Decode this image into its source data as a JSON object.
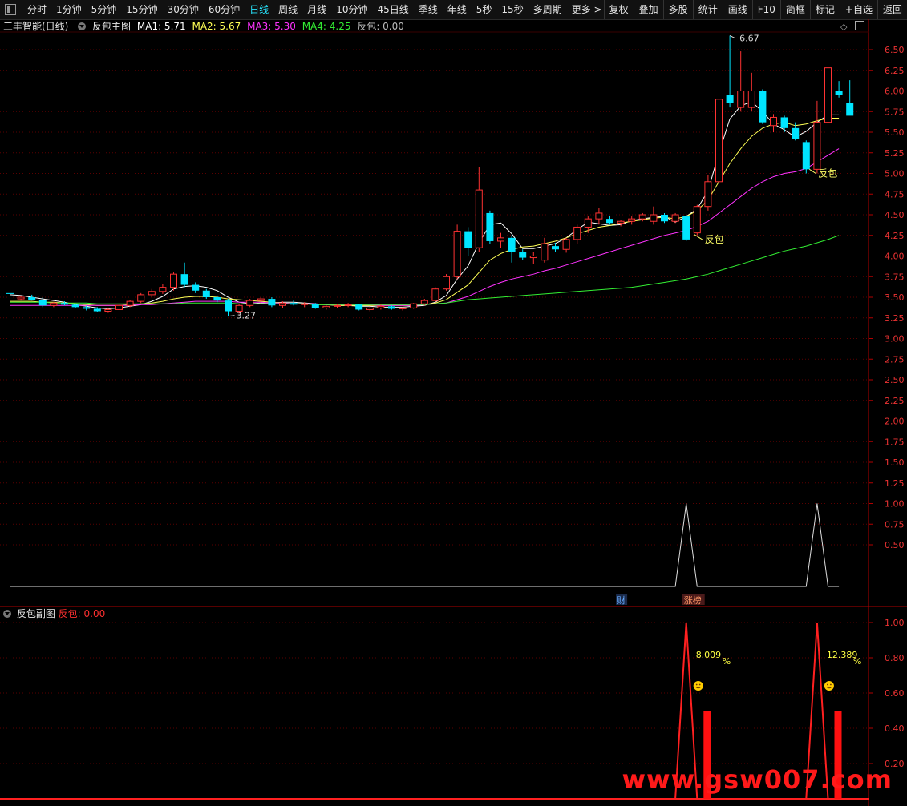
{
  "toolbar": {
    "left_items": [
      "分时",
      "1分钟",
      "5分钟",
      "15分钟",
      "30分钟",
      "60分钟",
      "日线",
      "周线",
      "月线",
      "10分钟",
      "45日线",
      "季线",
      "年线",
      "5秒",
      "15秒",
      "多周期",
      "更多 >"
    ],
    "active": "日线",
    "right_items": [
      "复权",
      "叠加",
      "多股",
      "统计",
      "画线",
      "F10",
      "简框",
      "标记",
      "+自选",
      "返回"
    ]
  },
  "main_header": {
    "title": "三丰智能(日线)",
    "indicator": "反包主图",
    "ma1": "MA1: 5.71",
    "ma2": "MA2: 5.67",
    "ma3": "MA3: 5.30",
    "ma4": "MA4: 4.25",
    "fanbao": "反包: 0.00"
  },
  "sub_header": {
    "indicator": "反包副图",
    "fanbao": "反包: 0.00"
  },
  "colors": {
    "up": "#ff3232",
    "down": "#00e5ff",
    "ma1": "#ffffff",
    "ma2": "#ffff55",
    "ma3": "#ff33ff",
    "ma4": "#33ee33",
    "axis": "#c00000"
  },
  "annotations": {
    "high_label": "6.67",
    "low_label": "3.27",
    "fanbao_label_1": "反包",
    "fanbao_label_2": "反包",
    "badge_cai": "财",
    "badge_zhangbang": "涨榜",
    "pct_1": "8.009",
    "pct_2": "12.389",
    "pct_unit": "%",
    "watermark": "www.gsw007.com"
  },
  "chart_data": [
    {
      "type": "candlestick",
      "title": "三丰智能(日线)",
      "ylim": [
        2.9,
        6.7
      ],
      "y_ticks": [
        "6.50",
        "6.25",
        "6.00",
        "5.75",
        "5.50",
        "5.25",
        "5.00",
        "4.75",
        "4.50",
        "4.25",
        "4.00",
        "3.75",
        "3.50",
        "3.25",
        "3.00",
        "2.75",
        "2.50",
        "2.25",
        "2.00",
        "1.75",
        "1.50",
        "1.25",
        "1.00",
        "0.75",
        "0.50"
      ],
      "candles": [
        [
          3.55,
          3.56,
          3.53,
          3.54
        ],
        [
          3.48,
          3.52,
          3.46,
          3.5
        ],
        [
          3.5,
          3.53,
          3.46,
          3.47
        ],
        [
          3.47,
          3.5,
          3.38,
          3.4
        ],
        [
          3.4,
          3.44,
          3.38,
          3.43
        ],
        [
          3.43,
          3.45,
          3.4,
          3.41
        ],
        [
          3.41,
          3.42,
          3.37,
          3.38
        ],
        [
          3.38,
          3.4,
          3.34,
          3.36
        ],
        [
          3.36,
          3.38,
          3.32,
          3.33
        ],
        [
          3.33,
          3.37,
          3.31,
          3.35
        ],
        [
          3.35,
          3.42,
          3.33,
          3.4
        ],
        [
          3.4,
          3.47,
          3.38,
          3.45
        ],
        [
          3.45,
          3.55,
          3.43,
          3.53
        ],
        [
          3.53,
          3.6,
          3.5,
          3.57
        ],
        [
          3.57,
          3.66,
          3.54,
          3.62
        ],
        [
          3.62,
          3.8,
          3.58,
          3.78
        ],
        [
          3.78,
          3.92,
          3.62,
          3.65
        ],
        [
          3.65,
          3.68,
          3.55,
          3.58
        ],
        [
          3.58,
          3.6,
          3.48,
          3.5
        ],
        [
          3.5,
          3.52,
          3.44,
          3.46
        ],
        [
          3.46,
          3.48,
          3.27,
          3.33
        ],
        [
          3.33,
          3.42,
          3.3,
          3.4
        ],
        [
          3.4,
          3.48,
          3.38,
          3.46
        ],
        [
          3.46,
          3.5,
          3.42,
          3.48
        ],
        [
          3.48,
          3.5,
          3.38,
          3.4
        ],
        [
          3.4,
          3.45,
          3.37,
          3.43
        ],
        [
          3.43,
          3.46,
          3.4,
          3.41
        ],
        [
          3.41,
          3.44,
          3.38,
          3.42
        ],
        [
          3.42,
          3.43,
          3.36,
          3.37
        ],
        [
          3.37,
          3.4,
          3.35,
          3.39
        ],
        [
          3.39,
          3.42,
          3.37,
          3.4
        ],
        [
          3.4,
          3.43,
          3.38,
          3.41
        ],
        [
          3.41,
          3.42,
          3.34,
          3.35
        ],
        [
          3.35,
          3.39,
          3.33,
          3.37
        ],
        [
          3.37,
          3.41,
          3.35,
          3.39
        ],
        [
          3.39,
          3.4,
          3.35,
          3.36
        ],
        [
          3.36,
          3.38,
          3.34,
          3.37
        ],
        [
          3.37,
          3.43,
          3.36,
          3.42
        ],
        [
          3.42,
          3.48,
          3.4,
          3.46
        ],
        [
          3.46,
          3.62,
          3.44,
          3.6
        ],
        [
          3.6,
          3.78,
          3.58,
          3.75
        ],
        [
          3.75,
          4.38,
          3.72,
          4.3
        ],
        [
          4.3,
          4.35,
          4.0,
          4.1
        ],
        [
          4.1,
          5.08,
          4.05,
          4.8
        ],
        [
          4.52,
          4.55,
          4.15,
          4.18
        ],
        [
          4.18,
          4.28,
          4.1,
          4.22
        ],
        [
          4.22,
          4.25,
          3.92,
          4.05
        ],
        [
          4.05,
          4.08,
          3.95,
          3.98
        ],
        [
          3.98,
          4.05,
          3.9,
          4.0
        ],
        [
          3.95,
          4.22,
          3.92,
          4.15
        ],
        [
          4.12,
          4.16,
          4.05,
          4.08
        ],
        [
          4.08,
          4.22,
          4.04,
          4.2
        ],
        [
          4.2,
          4.38,
          4.15,
          4.35
        ],
        [
          4.35,
          4.48,
          4.28,
          4.45
        ],
        [
          4.45,
          4.58,
          4.38,
          4.52
        ],
        [
          4.45,
          4.48,
          4.38,
          4.4
        ],
        [
          4.4,
          4.44,
          4.36,
          4.42
        ],
        [
          4.42,
          4.48,
          4.38,
          4.45
        ],
        [
          4.45,
          4.52,
          4.42,
          4.5
        ],
        [
          4.42,
          4.6,
          4.38,
          4.5
        ],
        [
          4.5,
          4.52,
          4.4,
          4.42
        ],
        [
          4.42,
          4.52,
          4.4,
          4.5
        ],
        [
          4.48,
          4.5,
          4.18,
          4.2
        ],
        [
          4.28,
          4.62,
          4.25,
          4.6
        ],
        [
          4.6,
          4.98,
          4.55,
          4.9
        ],
        [
          4.9,
          5.95,
          4.85,
          5.9
        ],
        [
          5.95,
          6.67,
          5.8,
          5.85
        ],
        [
          5.8,
          6.48,
          5.75,
          6.0
        ],
        [
          5.8,
          6.22,
          5.75,
          6.0
        ],
        [
          6.0,
          6.02,
          5.6,
          5.62
        ],
        [
          5.58,
          5.72,
          5.5,
          5.68
        ],
        [
          5.68,
          5.7,
          5.5,
          5.55
        ],
        [
          5.55,
          5.62,
          5.4,
          5.42
        ],
        [
          5.38,
          5.4,
          5.0,
          5.05
        ],
        [
          5.05,
          5.88,
          5.0,
          5.62
        ],
        [
          5.62,
          6.35,
          5.6,
          6.28
        ],
        [
          6.0,
          6.12,
          5.92,
          5.95
        ],
        [
          5.85,
          6.13,
          5.72,
          5.7
        ]
      ],
      "series": [
        {
          "name": "MA1",
          "values": [
            3.53,
            3.52,
            3.5,
            3.48,
            3.46,
            3.44,
            3.41,
            3.39,
            3.37,
            3.36,
            3.37,
            3.39,
            3.41,
            3.45,
            3.51,
            3.6,
            3.63,
            3.64,
            3.62,
            3.58,
            3.5,
            3.44,
            3.42,
            3.43,
            3.43,
            3.44,
            3.44,
            3.43,
            3.42,
            3.41,
            3.4,
            3.4,
            3.39,
            3.39,
            3.38,
            3.38,
            3.38,
            3.39,
            3.4,
            3.44,
            3.52,
            3.72,
            3.88,
            4.16,
            4.38,
            4.4,
            4.27,
            4.09,
            4.09,
            4.12,
            4.15,
            4.22,
            4.32,
            4.41,
            4.39,
            4.37,
            4.38,
            4.43,
            4.45,
            4.47,
            4.48,
            4.41,
            4.48,
            4.57,
            4.79,
            5.25,
            5.66,
            5.82,
            5.87,
            5.75,
            5.6,
            5.53,
            5.44,
            5.51,
            5.62,
            5.71,
            5.71
          ]
        },
        {
          "name": "MA2",
          "values": [
            3.45,
            3.45,
            3.45,
            3.44,
            3.44,
            3.43,
            3.42,
            3.41,
            3.4,
            3.4,
            3.4,
            3.41,
            3.42,
            3.43,
            3.45,
            3.48,
            3.5,
            3.51,
            3.51,
            3.5,
            3.48,
            3.47,
            3.46,
            3.45,
            3.44,
            3.43,
            3.42,
            3.42,
            3.41,
            3.41,
            3.4,
            3.4,
            3.4,
            3.4,
            3.4,
            3.4,
            3.4,
            3.4,
            3.41,
            3.43,
            3.47,
            3.56,
            3.65,
            3.8,
            3.95,
            4.03,
            4.08,
            4.11,
            4.12,
            4.15,
            4.18,
            4.22,
            4.27,
            4.31,
            4.35,
            4.37,
            4.4,
            4.42,
            4.44,
            4.46,
            4.47,
            4.45,
            4.48,
            4.55,
            4.68,
            4.9,
            5.12,
            5.3,
            5.45,
            5.55,
            5.6,
            5.62,
            5.58,
            5.6,
            5.64,
            5.67,
            5.67
          ]
        },
        {
          "name": "MA3",
          "values": [
            3.4,
            3.4,
            3.4,
            3.4,
            3.4,
            3.4,
            3.4,
            3.4,
            3.4,
            3.4,
            3.4,
            3.4,
            3.41,
            3.41,
            3.42,
            3.43,
            3.44,
            3.45,
            3.45,
            3.45,
            3.45,
            3.44,
            3.44,
            3.44,
            3.43,
            3.43,
            3.42,
            3.42,
            3.42,
            3.41,
            3.41,
            3.41,
            3.41,
            3.41,
            3.4,
            3.4,
            3.4,
            3.4,
            3.41,
            3.42,
            3.43,
            3.47,
            3.51,
            3.57,
            3.63,
            3.68,
            3.72,
            3.75,
            3.78,
            3.82,
            3.85,
            3.89,
            3.93,
            3.97,
            4.01,
            4.05,
            4.09,
            4.13,
            4.17,
            4.21,
            4.25,
            4.28,
            4.31,
            4.36,
            4.42,
            4.52,
            4.62,
            4.72,
            4.82,
            4.9,
            4.96,
            5.0,
            5.02,
            5.06,
            5.14,
            5.22,
            5.3
          ]
        },
        {
          "name": "MA4",
          "values": [
            3.44,
            3.44,
            3.44,
            3.44,
            3.43,
            3.43,
            3.43,
            3.43,
            3.42,
            3.42,
            3.42,
            3.42,
            3.42,
            3.42,
            3.42,
            3.42,
            3.43,
            3.43,
            3.43,
            3.43,
            3.43,
            3.42,
            3.42,
            3.42,
            3.42,
            3.42,
            3.42,
            3.42,
            3.41,
            3.41,
            3.41,
            3.41,
            3.41,
            3.41,
            3.41,
            3.41,
            3.41,
            3.41,
            3.41,
            3.42,
            3.43,
            3.45,
            3.47,
            3.48,
            3.49,
            3.5,
            3.51,
            3.52,
            3.53,
            3.54,
            3.55,
            3.56,
            3.57,
            3.58,
            3.59,
            3.6,
            3.61,
            3.62,
            3.64,
            3.66,
            3.68,
            3.7,
            3.72,
            3.75,
            3.78,
            3.82,
            3.86,
            3.9,
            3.94,
            3.98,
            4.02,
            4.06,
            4.09,
            4.12,
            4.16,
            4.2,
            4.25
          ]
        },
        {
          "name": "反包",
          "values": [
            0,
            0,
            0,
            0,
            0,
            0,
            0,
            0,
            0,
            0,
            0,
            0,
            0,
            0,
            0,
            0,
            0,
            0,
            0,
            0,
            0,
            0,
            0,
            0,
            0,
            0,
            0,
            0,
            0,
            0,
            0,
            0,
            0,
            0,
            0,
            0,
            0,
            0,
            0,
            0,
            0,
            0,
            0,
            0,
            0,
            0,
            0,
            0,
            0,
            0,
            0,
            0,
            0,
            0,
            0,
            0,
            0,
            0,
            0,
            0,
            0,
            0,
            1,
            0,
            0,
            0,
            0,
            0,
            0,
            0,
            0,
            0,
            0,
            0,
            1,
            0,
            0
          ]
        }
      ]
    },
    {
      "type": "line",
      "title": "反包副图",
      "ylim": [
        0.1,
        1.05
      ],
      "y_ticks": [
        "1.00",
        "0.80",
        "0.60",
        "0.40",
        "0.20"
      ],
      "series": [
        {
          "name": "反包",
          "values": [
            0,
            0,
            0,
            0,
            0,
            0,
            0,
            0,
            0,
            0,
            0,
            0,
            0,
            0,
            0,
            0,
            0,
            0,
            0,
            0,
            0,
            0,
            0,
            0,
            0,
            0,
            0,
            0,
            0,
            0,
            0,
            0,
            0,
            0,
            0,
            0,
            0,
            0,
            0,
            0,
            0,
            0,
            0,
            0,
            0,
            0,
            0,
            0,
            0,
            0,
            0,
            0,
            0,
            0,
            0,
            0,
            0,
            0,
            0,
            0,
            0,
            0,
            1,
            0,
            0,
            0,
            0,
            0,
            0,
            0,
            0,
            0,
            0,
            0,
            1,
            0,
            0
          ]
        }
      ],
      "bars": [
        {
          "index": 63,
          "value": 0.5
        },
        {
          "index": 75,
          "value": 0.5
        }
      ]
    }
  ]
}
